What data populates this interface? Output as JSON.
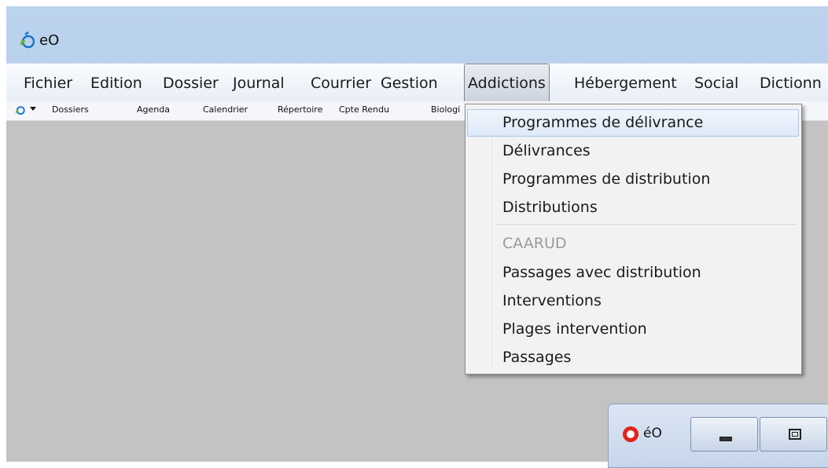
{
  "window": {
    "title": "eO"
  },
  "menubar": {
    "items": [
      "Fichier",
      "Edition",
      "Dossier",
      "Journal",
      "Courrier",
      "Gestion",
      "Addictions",
      "Hébergement",
      "Social",
      "Dictionn"
    ],
    "active": "Addictions"
  },
  "toolbar": {
    "items": [
      "Dossiers",
      "Agenda",
      "Calendrier",
      "Répertoire",
      "Cpte Rendu",
      "Biologi"
    ]
  },
  "dropdown": {
    "items": [
      {
        "label": "Programmes de délivrance",
        "state": "highlighted"
      },
      {
        "label": "Délivrances",
        "state": "normal"
      },
      {
        "label": "Programmes de distribution",
        "state": "normal"
      },
      {
        "label": "Distributions",
        "state": "normal"
      },
      {
        "label": "CAARUD",
        "state": "disabled"
      },
      {
        "label": "Passages avec distribution",
        "state": "normal"
      },
      {
        "label": "Interventions",
        "state": "normal"
      },
      {
        "label": "Plages intervention",
        "state": "normal"
      },
      {
        "label": "Passages",
        "state": "normal"
      }
    ]
  },
  "mini_window": {
    "title": "éO"
  },
  "colors": {
    "accent": "#a9c6ec",
    "workspace": "#c3c3c3",
    "title_bg": "#bcd3ee",
    "logo_blue": "#1a73c8",
    "logo_green": "#5bb334"
  }
}
